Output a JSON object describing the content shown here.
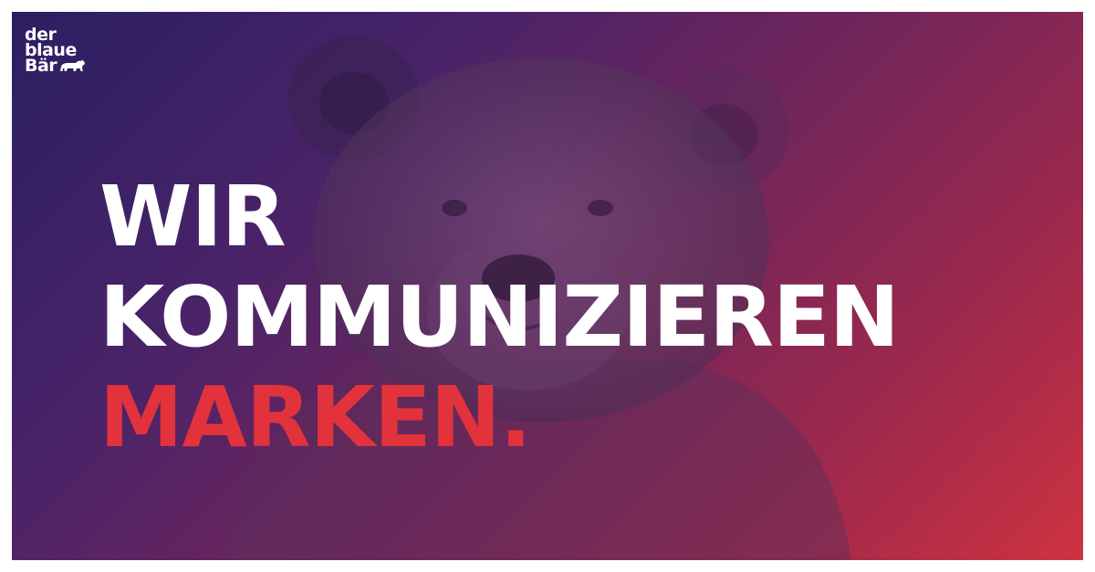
{
  "logo": {
    "line1": "der",
    "line2": "blaue",
    "line3": "Bär",
    "icon": "bear-icon"
  },
  "headline": {
    "line1": "WIR",
    "line2": "KOMMUNIZIEREN",
    "line3": "MARKEN."
  },
  "colors": {
    "gradient_start": "#2b1f62",
    "gradient_end": "#cf3340",
    "headline_white": "#ffffff",
    "headline_accent": "#e2323c"
  }
}
